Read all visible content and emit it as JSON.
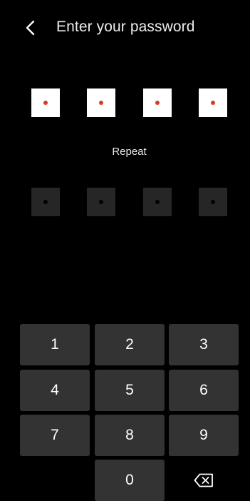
{
  "header": {
    "back_icon": "chevron-left-icon",
    "title": "Enter your password"
  },
  "password": {
    "length": 4,
    "entered": 4,
    "filled_color": "#ffffff",
    "dot_color": "#d93a2b"
  },
  "repeat": {
    "label": "Repeat",
    "length": 4,
    "entered": 0,
    "empty_color": "#262626"
  },
  "keypad": {
    "keys": [
      "1",
      "2",
      "3",
      "4",
      "5",
      "6",
      "7",
      "8",
      "9",
      "0"
    ],
    "backspace_icon": "backspace-icon",
    "key_color": "#333333"
  }
}
